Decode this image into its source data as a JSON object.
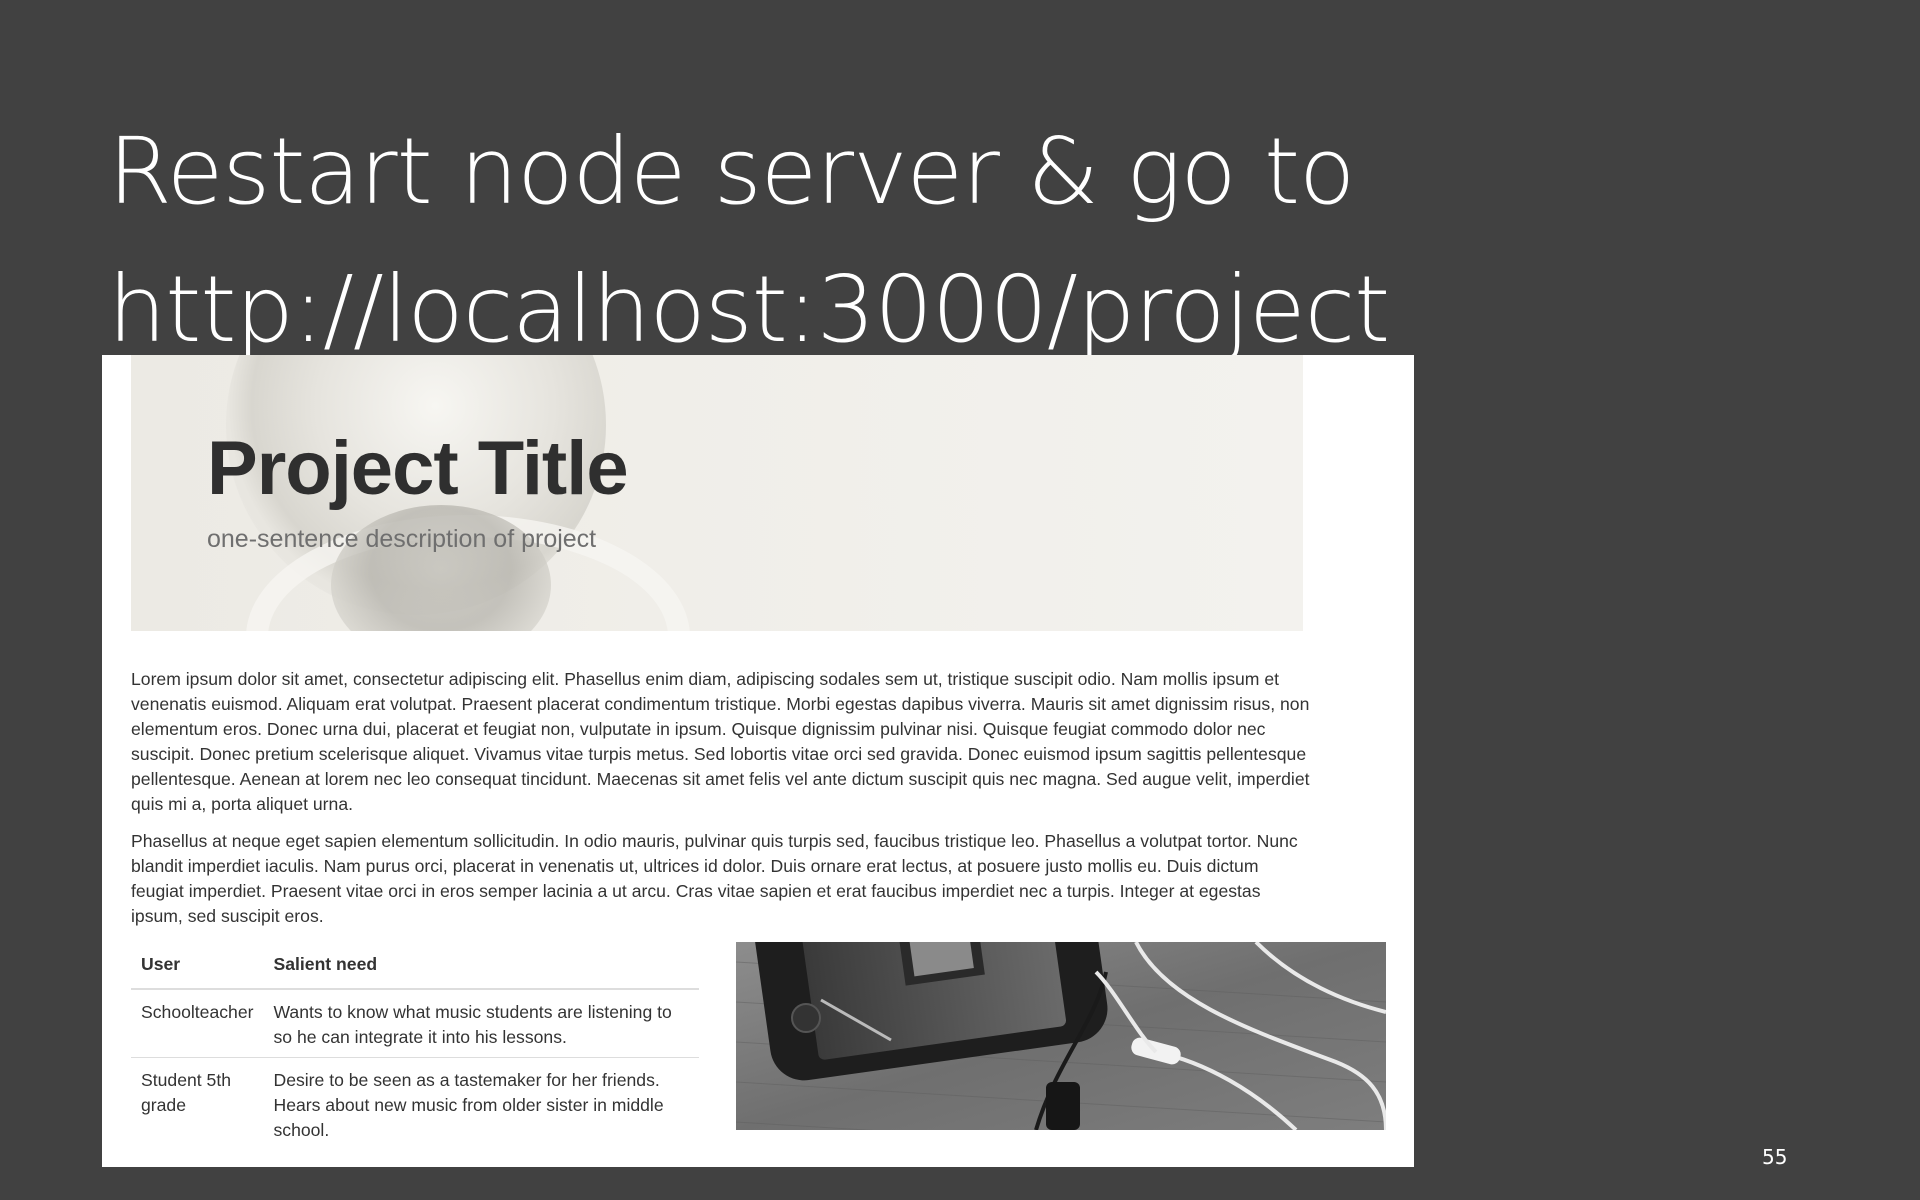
{
  "slide": {
    "title_line_1": "Restart node server & go to",
    "title_line_2": "http://localhost:3000/project",
    "page_number": "55"
  },
  "screenshot": {
    "hero": {
      "title": "Project Title",
      "subtitle": "one-sentence description of project"
    },
    "paragraphs": [
      "Lorem ipsum dolor sit amet, consectetur adipiscing elit. Phasellus enim diam, adipiscing sodales sem ut, tristique suscipit odio. Nam mollis ipsum et venenatis euismod. Aliquam erat volutpat. Praesent placerat condimentum tristique. Morbi egestas dapibus viverra. Mauris sit amet dignissim risus, non elementum eros. Donec urna dui, placerat et feugiat non, vulputate in ipsum. Quisque dignissim pulvinar nisi. Quisque feugiat commodo dolor nec suscipit. Donec pretium scelerisque aliquet. Vivamus vitae turpis metus. Sed lobortis vitae orci sed gravida. Donec euismod ipsum sagittis pellentesque pellentesque. Aenean at lorem nec leo consequat tincidunt. Maecenas sit amet felis vel ante dictum suscipit quis nec magna. Sed augue velit, imperdiet quis mi a, porta aliquet urna.",
      "Phasellus at neque eget sapien elementum sollicitudin. In odio mauris, pulvinar quis turpis sed, faucibus tristique leo. Phasellus a volutpat tortor. Nunc blandit imperdiet iaculis. Nam purus orci, placerat in venenatis ut, ultrices id dolor. Duis ornare erat lectus, at posuere justo mollis eu. Duis dictum feugiat imperdiet. Praesent vitae orci in eros semper lacinia a ut arcu. Cras vitae sapien et erat faucibus imperdiet nec a turpis. Integer at egestas ipsum, sed suscipit eros."
    ],
    "table": {
      "headers": [
        "User",
        "Salient need"
      ],
      "rows": [
        [
          "Schoolteacher",
          "Wants to know what music students are listening to so he can integrate it into his lessons."
        ],
        [
          "Student 5th grade",
          "Desire to be seen as a tastemaker for her friends. Hears about new music from older sister in middle school."
        ]
      ]
    },
    "photo": {
      "subject": "phone-with-earphones-photo"
    }
  }
}
